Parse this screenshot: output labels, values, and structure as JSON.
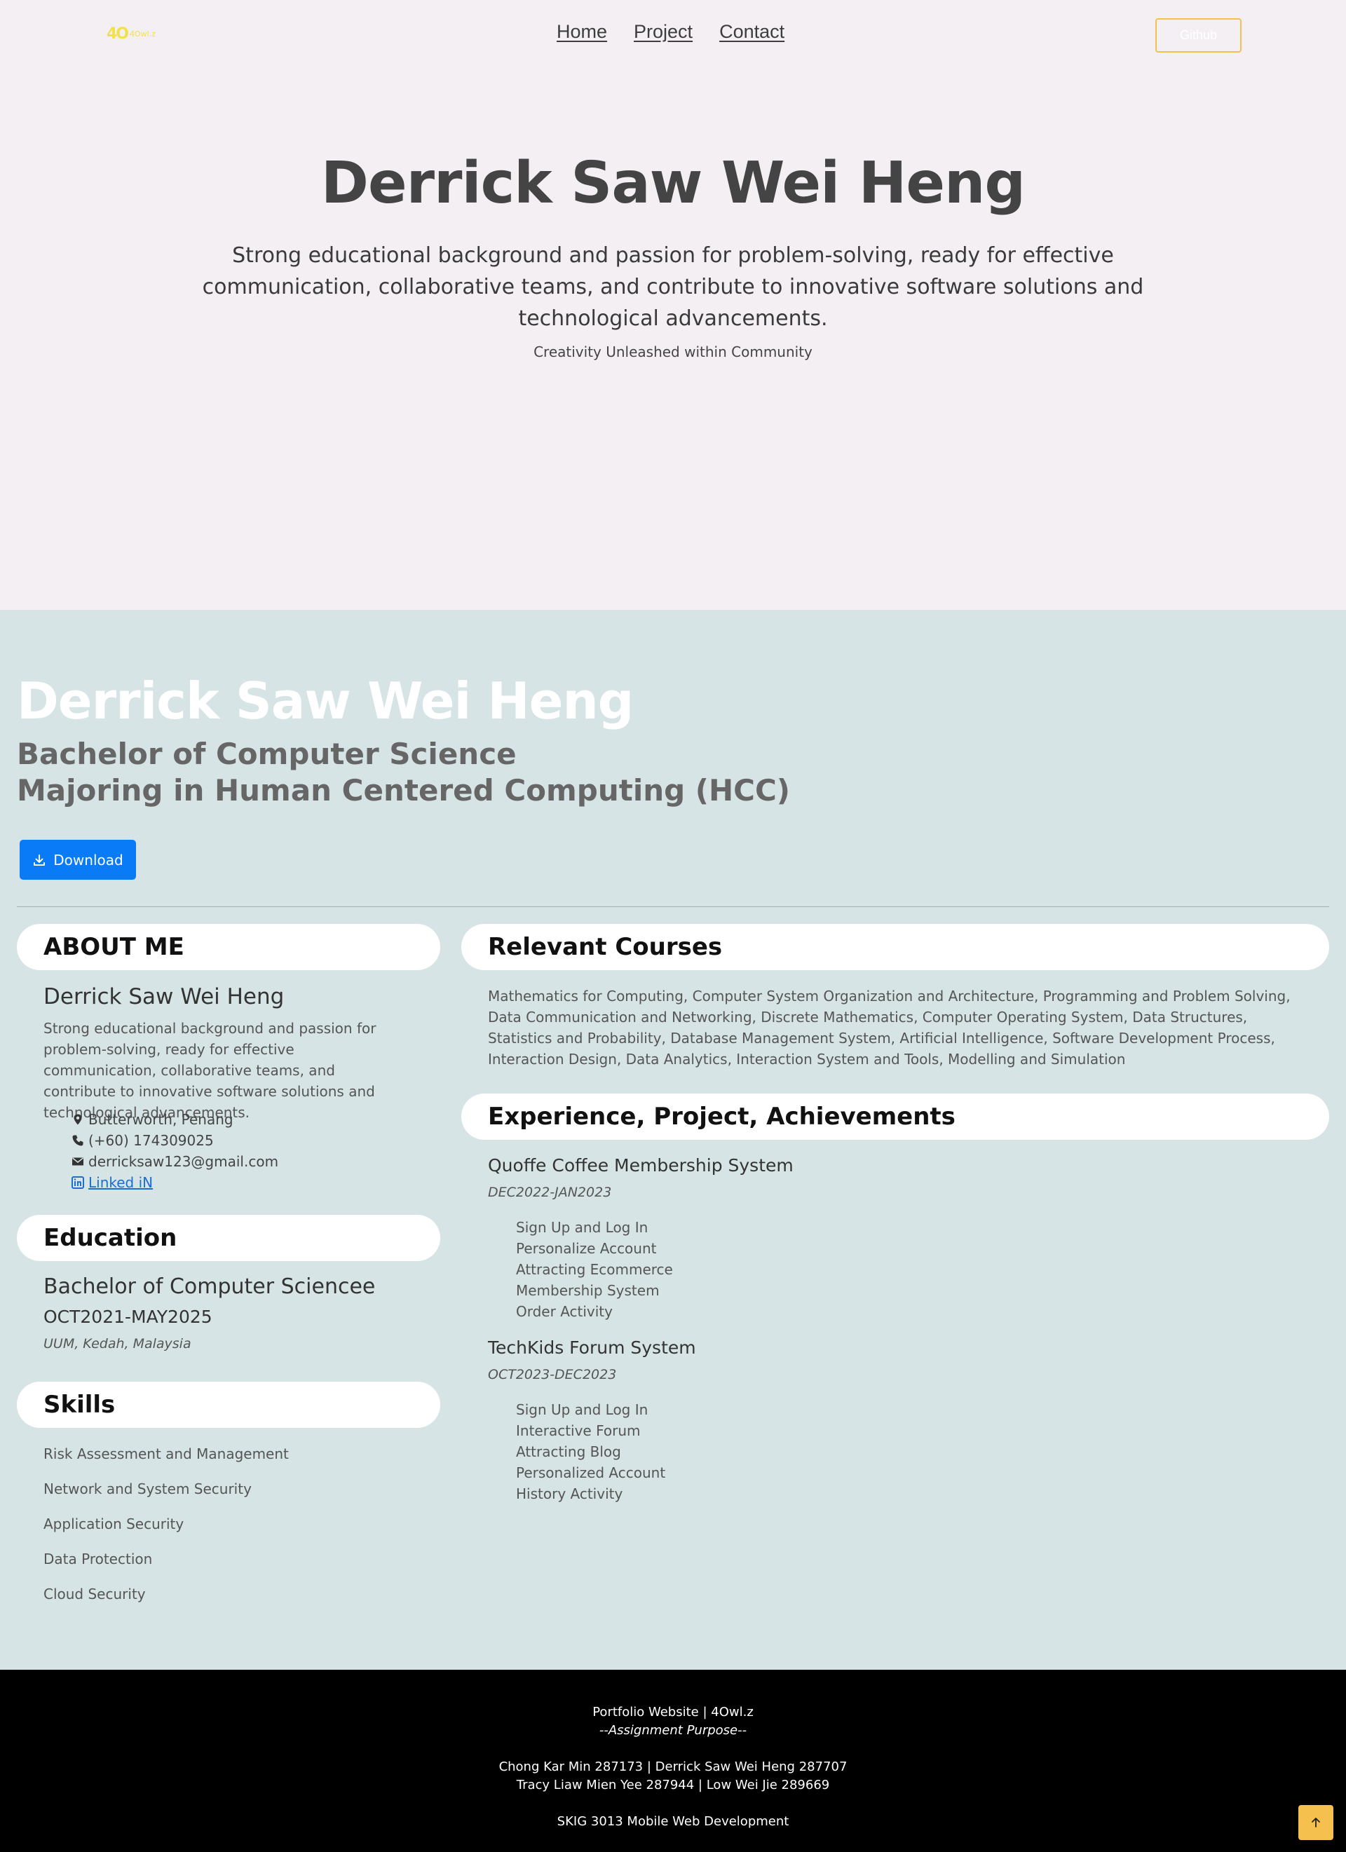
{
  "header": {
    "logo_mark": "4O",
    "logo_text": "4Owl.z",
    "nav": [
      "Home",
      "Project",
      "Contact"
    ],
    "github_label": "Github"
  },
  "hero": {
    "title": "Derrick Saw Wei Heng",
    "description": "Strong educational background and passion for problem-solving, ready for effective communication, collaborative teams, and contribute to innovative software solutions and technological advancements.",
    "tagline": "Creativity Unleashed within Community"
  },
  "resume": {
    "name": "Derrick Saw Wei Heng",
    "degree_line1": "Bachelor of Computer Science",
    "degree_line2": "Majoring in Human Centered Computing (HCC)",
    "download_label": "Download",
    "about": {
      "heading": "ABOUT ME",
      "name": "Derrick Saw Wei Heng",
      "text": "Strong educational background and passion for problem-solving, ready for effective communication, collaborative teams, and contribute to innovative software solutions and technological advancements.",
      "location": "Butterworth, Penang",
      "phone": "(+60) 174309025",
      "email": "derricksaw123@gmail.com",
      "linkedin": " Linked iN"
    },
    "education": {
      "heading": "Education",
      "degree": "Bachelor of Computer Sciencee",
      "date": "OCT2021-MAY2025",
      "place": "UUM, Kedah, Malaysia"
    },
    "skills": {
      "heading": "Skills",
      "items": [
        "Risk Assessment and Management",
        "Network and System Security",
        "Application Security",
        "Data Protection",
        "Cloud Security"
      ]
    },
    "courses": {
      "heading": "Relevant Courses",
      "text": "Mathematics for Computing, Computer System Organization and Architecture, Programming and Problem Solving, Data Communication and Networking, Discrete Mathematics, Computer Operating System, Data Structures, Statistics and Probability, Database Management System, Artificial Intelligence, Software Development Process, Interaction Design, Data Analytics, Interaction System and Tools, Modelling and Simulation"
    },
    "experience": {
      "heading": "Experience, Project, Achievements",
      "projects": [
        {
          "title": "Quoffe Coffee Membership System",
          "date": "DEC2022-JAN2023",
          "items": [
            "Sign Up and Log In",
            "Personalize Account",
            "Attracting Ecommerce",
            "Membership System",
            "Order Activity"
          ]
        },
        {
          "title": "TechKids Forum System",
          "date": "OCT2023-DEC2023",
          "items": [
            "Sign Up and Log In",
            "Interactive Forum",
            "Attracting Blog",
            "Personalized Account",
            "History Activity"
          ]
        }
      ]
    }
  },
  "footer": {
    "line1": "Portfolio Website | 4Owl.z",
    "line2": "--Assignment Purpose--",
    "line3": "Chong Kar Min 287173 | Derrick Saw Wei Heng 287707",
    "line4": "Tracy Liaw Mien Yee 287944 | Low Wei Jie 289669",
    "line5": "SKIG 3013 Mobile Web Development"
  },
  "colors": {
    "hero_bg": "#f4eff3",
    "resume_bg": "#d6e4e5",
    "accent_yellow": "#f5c04e",
    "download_blue": "#0a7bf7",
    "footer_bg": "#000000"
  },
  "icons": {
    "location": "map-pin-icon",
    "phone": "phone-icon",
    "email": "envelope-icon",
    "linkedin": "linkedin-icon",
    "download": "download-icon",
    "back_to_top": "arrow-up-icon"
  }
}
